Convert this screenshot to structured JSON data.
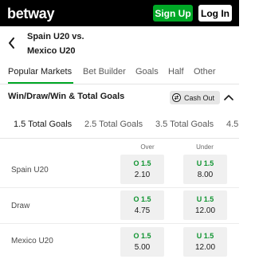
{
  "header": {
    "logo": "betway",
    "signup_label": "Sign Up",
    "login_label": "Log In"
  },
  "event": {
    "home": "Spain U20 vs.",
    "away": "Mexico U20"
  },
  "tabs": [
    {
      "label": "Popular Markets",
      "active": true
    },
    {
      "label": "Bet Builder",
      "active": false
    },
    {
      "label": "Goals",
      "active": false
    },
    {
      "label": "Half",
      "active": false
    },
    {
      "label": "Other",
      "active": false
    }
  ],
  "market": {
    "title": "Win/Draw/Win & Total Goals",
    "cashout_label": "Cash Out"
  },
  "subtabs": [
    {
      "label": "1.5 Total Goals",
      "active": true
    },
    {
      "label": "2.5 Total Goals",
      "active": false
    },
    {
      "label": "3.5 Total Goals",
      "active": false
    },
    {
      "label": "4.5",
      "active": false
    }
  ],
  "columns": {
    "over": "Over",
    "under": "Under"
  },
  "rows": [
    {
      "label": "Spain U20",
      "over_line": "O 1.5",
      "over_price": "2.10",
      "under_line": "U 1.5",
      "under_price": "8.00"
    },
    {
      "label": "Draw",
      "over_line": "O 1.5",
      "over_price": "4.75",
      "under_line": "U 1.5",
      "under_price": "12.00"
    },
    {
      "label": "Mexico U20",
      "over_line": "O 1.5",
      "over_price": "5.00",
      "under_line": "U 1.5",
      "under_price": "12.00"
    }
  ],
  "colors": {
    "brand_green": "#00a826",
    "line_green": "#0f9430",
    "topbar": "#000000"
  }
}
